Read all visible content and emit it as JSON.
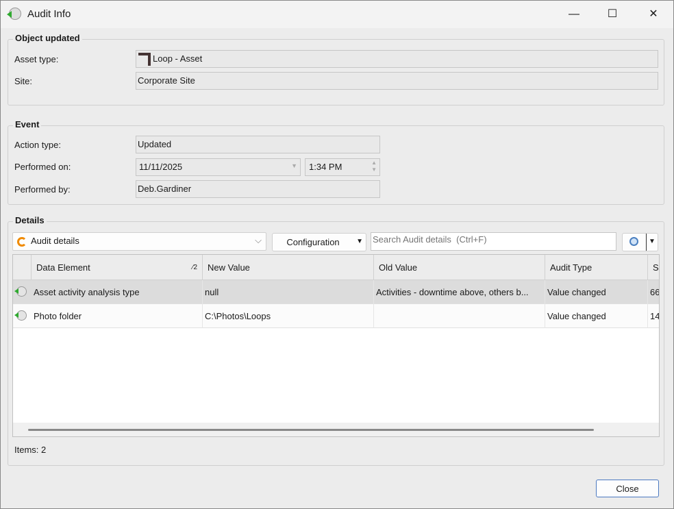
{
  "window": {
    "title": "Audit Info"
  },
  "object_updated": {
    "title": "Object updated",
    "asset_type_label": "Asset type:",
    "asset_type": "Loop - Asset",
    "site_label": "Site:",
    "site": "Corporate Site"
  },
  "event": {
    "title": "Event",
    "action_type_label": "Action type:",
    "action_type": "Updated",
    "performed_on_label": "Performed on:",
    "date": "11/11/2025",
    "time": "1:34 PM",
    "performed_by_label": "Performed by:",
    "performed_by": "Deb.Gardiner"
  },
  "details": {
    "title": "Details",
    "view": "Audit details",
    "configuration": "Configuration",
    "search_placeholder": "Search Audit details  (Ctrl+F)",
    "columns": [
      {
        "label": "Data Element",
        "sort": "2"
      },
      {
        "label": "New Value"
      },
      {
        "label": "Old Value"
      },
      {
        "label": "Audit Type"
      },
      {
        "label": "S"
      }
    ],
    "rows": [
      {
        "data_element": "Asset activity analysis type",
        "new_value": "null",
        "old_value": "Activities - downtime above, others b...",
        "audit_type": "Value changed",
        "extra": "66"
      },
      {
        "data_element": "Photo folder",
        "new_value": "C:\\Photos\\Loops",
        "old_value": "",
        "audit_type": "Value changed",
        "extra": "14"
      }
    ],
    "items": "Items: 2"
  },
  "footer": {
    "close": "Close"
  }
}
